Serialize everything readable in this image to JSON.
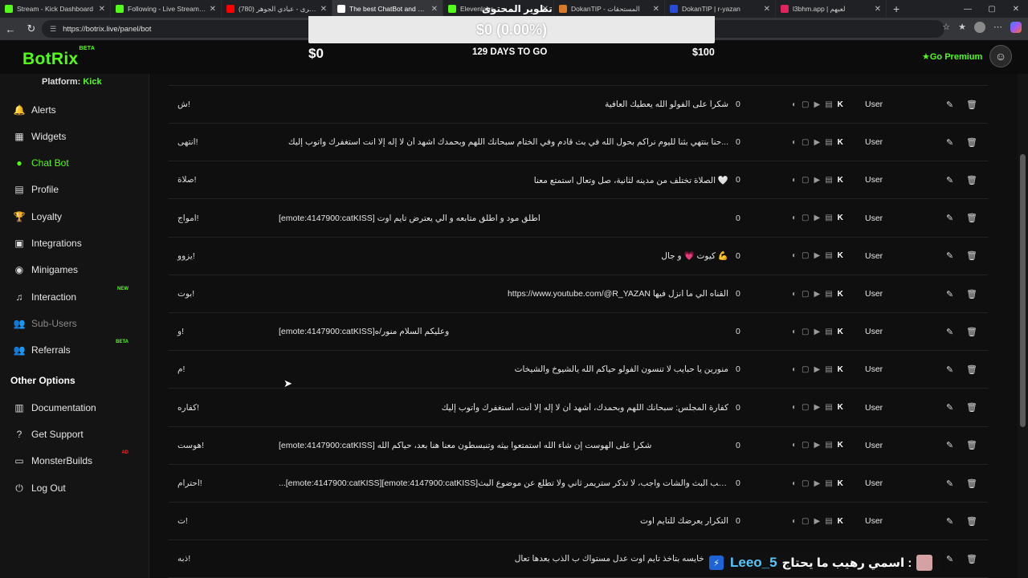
{
  "browser": {
    "tabs": [
      {
        "title": "Stream - Kick Dashboard",
        "color": "#53fc18"
      },
      {
        "title": "Following - Live Streams on",
        "color": "#53fc18"
      },
      {
        "title": "(780) قالو ترى - عبادي الجوهر",
        "color": "#ff0000"
      },
      {
        "title": "The best ChatBot and Widg",
        "color": "#ffffff",
        "active": true
      },
      {
        "title": "Elevenlabs",
        "color": "#53fc18"
      },
      {
        "title": "DokanTIP - المستحقات",
        "color": "#d97a2a"
      },
      {
        "title": "DokanTIP | r-yazan",
        "color": "#2a4bd9"
      },
      {
        "title": "l3bhm.app | لعبهم",
        "color": "#e0245e"
      }
    ],
    "url": "https://botrix.live/panel/bot"
  },
  "header": {
    "logo": "BotRix",
    "logo_badge": "BETA",
    "overlay_title": "تطوير المحتوى",
    "goal_bar_text": "$0 (0.00%)",
    "goal_progress": 0,
    "goal_current": "$0",
    "goal_days": "129 DAYS TO GO",
    "goal_target": "$100",
    "premium": "Go Premium"
  },
  "sidebar": {
    "platform_label": "Platform:",
    "platform_value": "Kick",
    "items": [
      {
        "label": "Alerts",
        "icon": "bell-icon"
      },
      {
        "label": "Widgets",
        "icon": "grid-icon"
      },
      {
        "label": "Chat Bot",
        "icon": "robot-icon",
        "active": true
      },
      {
        "label": "Profile",
        "icon": "id-card-icon"
      },
      {
        "label": "Loyalty",
        "icon": "trophy-icon"
      },
      {
        "label": "Integrations",
        "icon": "plug-icon"
      },
      {
        "label": "Minigames",
        "icon": "gamepad-icon"
      },
      {
        "label": "Interaction",
        "icon": "music-icon",
        "badge": "NEW"
      },
      {
        "label": "Sub-Users",
        "icon": "users-icon",
        "disabled": true
      },
      {
        "label": "Referrals",
        "icon": "user-group-icon",
        "badge": "BETA"
      }
    ],
    "other_title": "Other Options",
    "other_items": [
      {
        "label": "Documentation",
        "icon": "book-icon"
      },
      {
        "label": "Get Support",
        "icon": "question-icon"
      },
      {
        "label": "MonsterBuilds",
        "icon": "monitor-icon",
        "badge": "AD"
      },
      {
        "label": "Log Out",
        "icon": "logout-icon"
      }
    ]
  },
  "commands": [
    {
      "cmd": "!ش",
      "response": "شكراً على الفولو الله يعطيك العافية",
      "uses": "0",
      "perm": "User"
    },
    {
      "cmd": "!انتهى",
      "response": "...حنا بنتهي بثنا لليوم نراكم بحول الله في بث قادم وفي الختام سبحانك اللهم وبحمدك اشهد أن لا إله إلا انت استغفرك واتوب إليك",
      "uses": "0",
      "perm": "User"
    },
    {
      "cmd": "!صلاة",
      "response": "🤍 الصلاة تختلف من مدينه لثانية، صل وتعال استمتع معنا",
      "uses": "0",
      "perm": "User"
    },
    {
      "cmd": "!امواج",
      "response": "[emote:4147900:catKISS] اطلق مود و اطلق متابعه و الي يعترض تايم اوت",
      "uses": "0",
      "perm": "User"
    },
    {
      "cmd": "!يزوو",
      "response": "💪 كيوت 💗 و جال",
      "uses": "0",
      "perm": "User"
    },
    {
      "cmd": "!بوت",
      "response": "القناه الي ما انزل فيها https://www.youtube.com/@R_YAZAN",
      "uses": "0",
      "perm": "User"
    },
    {
      "cmd": "!و",
      "response": "[emote:4147900:catKISS]وعليكم السلام منور/ه",
      "uses": "0",
      "perm": "User"
    },
    {
      "cmd": "!م",
      "response": "منورين يا حبايب لا تنسون الفولو حياكم الله يالشيوخ والشيخات",
      "uses": "0",
      "perm": "User"
    },
    {
      "cmd": "!كفاره",
      "response": "كفارة المجلس: سبحانك اللهم وبحمدك، أشهد أن لا إله إلا أنت، أستغفرك وأتوب إليك",
      "uses": "0",
      "perm": "User"
    },
    {
      "cmd": "!هوست",
      "response": "[emote:4147900:catKISS] شكرا على الهوست إن شاء الله استمتعوا بيثه وتنبسطون معنا هنا بعد، حياكم الله",
      "uses": "0",
      "perm": "User"
    },
    {
      "cmd": "!احترام",
      "response": "...[emote:4147900:catKISS][emote:4147900:catKISS]احترامك لصاحب البث والشات واجب، لا تذكر ستريمر ثاني ولا تطلع عن موضوع البث",
      "uses": "0",
      "perm": "User"
    },
    {
      "cmd": "!ت",
      "response": "التكرار يعرضك للتايم اوت",
      "uses": "0",
      "perm": "User"
    },
    {
      "cmd": "!ذبه",
      "response": "اي ذبه خايسه بتاخذ تايم اوت عدل مستواك ب الذب بعدها تعال",
      "uses": "0",
      "perm": "User"
    }
  ],
  "chat_overlay": {
    "name": "Leeo_5",
    "message": "اسمي رهيب ما يحتاج :"
  }
}
